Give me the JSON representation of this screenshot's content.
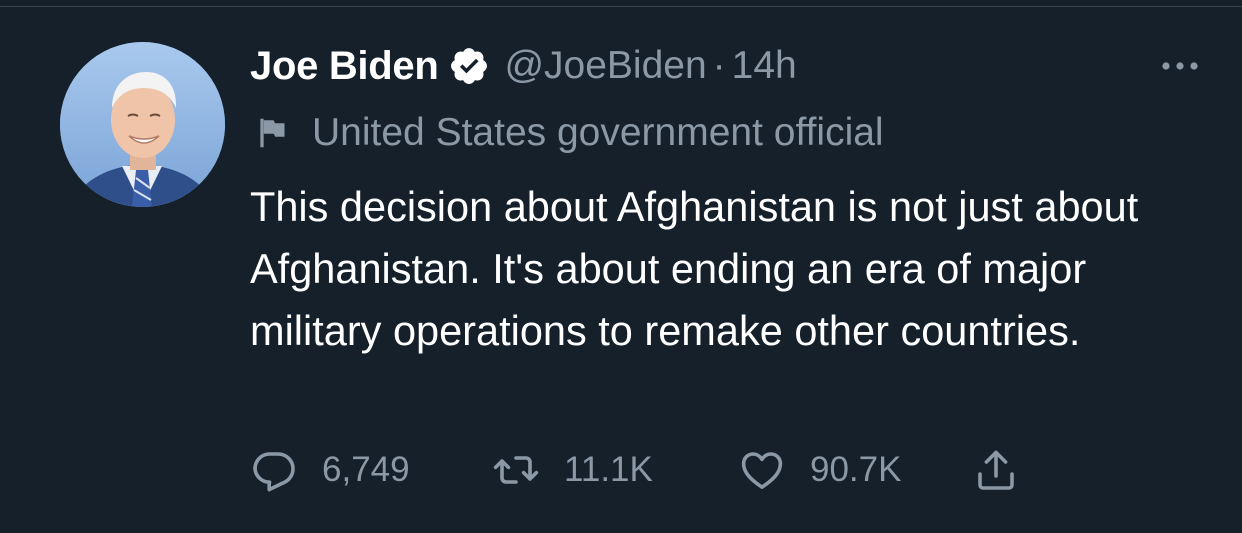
{
  "tweet": {
    "author": {
      "display_name": "Joe Biden",
      "handle": "@JoeBiden",
      "verified": true
    },
    "separator": "·",
    "timestamp": "14h",
    "label": "United States government official",
    "text": "This decision about Afghanistan is not just about Afghanistan. It's about ending an era of major military operations to remake other countries.",
    "metrics": {
      "replies": "6,749",
      "retweets": "11.1K",
      "likes": "90.7K"
    }
  },
  "icons": {
    "avatar": "avatar-photo",
    "verified": "verified-badge-icon",
    "flag": "flag-icon",
    "more": "more-options-icon",
    "reply": "reply-icon",
    "retweet": "retweet-icon",
    "like": "heart-icon",
    "share": "share-icon"
  },
  "colors": {
    "background": "#15202b",
    "text_primary": "#ffffff",
    "text_secondary": "#8b98a5",
    "divider": "#38444d"
  }
}
